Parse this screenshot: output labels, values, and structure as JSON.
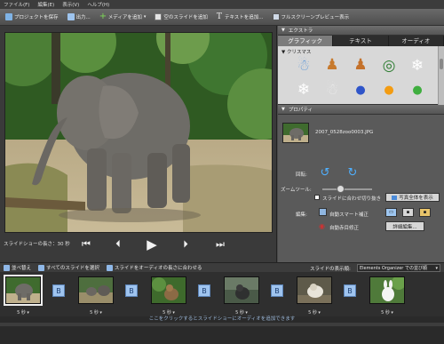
{
  "menu": {
    "file": "ファイル(F)",
    "edit": "編集(E)",
    "view": "表示(V)",
    "help": "ヘルプ(H)"
  },
  "toolbar": {
    "save": "プロジェクトを保存",
    "output": "出力...",
    "add_media": "メディアを追加",
    "add_blank": "空のスライドを追加",
    "add_text": "テキストを追加...",
    "fullscreen": "フルスクリーンプレビュー表示"
  },
  "preview": {
    "duration_label": "スライドショーの長さ：30 秒"
  },
  "extras": {
    "header": "エクストラ",
    "tabs": [
      "グラフィック",
      "テキスト",
      "オーディオ"
    ],
    "active_tab": 0,
    "category": "クリスマス",
    "items": [
      "snowman-icon",
      "gingerbread-icon",
      "gingerbread-icon",
      "wreath-icon",
      "snowflake-icon",
      "snowflake-icon",
      "snowman-icon",
      "ornament-blue-icon",
      "ornament-orange-icon",
      "ornament-green-icon"
    ]
  },
  "properties": {
    "header": "プロパティ",
    "file_name": "2007_0528zoo0003.JPG",
    "rotate_label": "回転:",
    "zoom_label": "ズームツール:",
    "zoom_value": 0.35,
    "fit_slide_label": "スライドに合わせ切り抜き",
    "fit_slide_checked": true,
    "fit_photo_label": "写真全体を表示",
    "edit_label": "編集:",
    "auto_smart_fix": "自動スマート補正",
    "auto_red_eye": "自動赤目修正",
    "advanced_edit": "詳細編集..."
  },
  "storyboard_toolbar": {
    "reorder": "並べ替え",
    "select_all": "すべてのスライドを選択",
    "fit_audio": "スライドをオーディオの長さに合わせる",
    "display_label": "スライドの表示順:",
    "display_value": "Elements Organizer での並び順"
  },
  "storyboard": {
    "slides": [
      {
        "duration": "5 秒 ▾",
        "selected": true
      },
      {
        "duration": "5 秒 ▾",
        "selected": false
      },
      {
        "duration": "5 秒 ▾",
        "selected": false
      },
      {
        "duration": "5 秒 ▾",
        "selected": false
      },
      {
        "duration": "5 秒 ▾",
        "selected": false
      },
      {
        "duration": "5 秒 ▾",
        "selected": false
      }
    ],
    "transition_label": "B",
    "audio_hint": "ここをクリックするとスライドショーにオーディオを追加できます"
  },
  "colors": {
    "accent": "#4fb0ff",
    "selection": "#f0f0f0"
  }
}
